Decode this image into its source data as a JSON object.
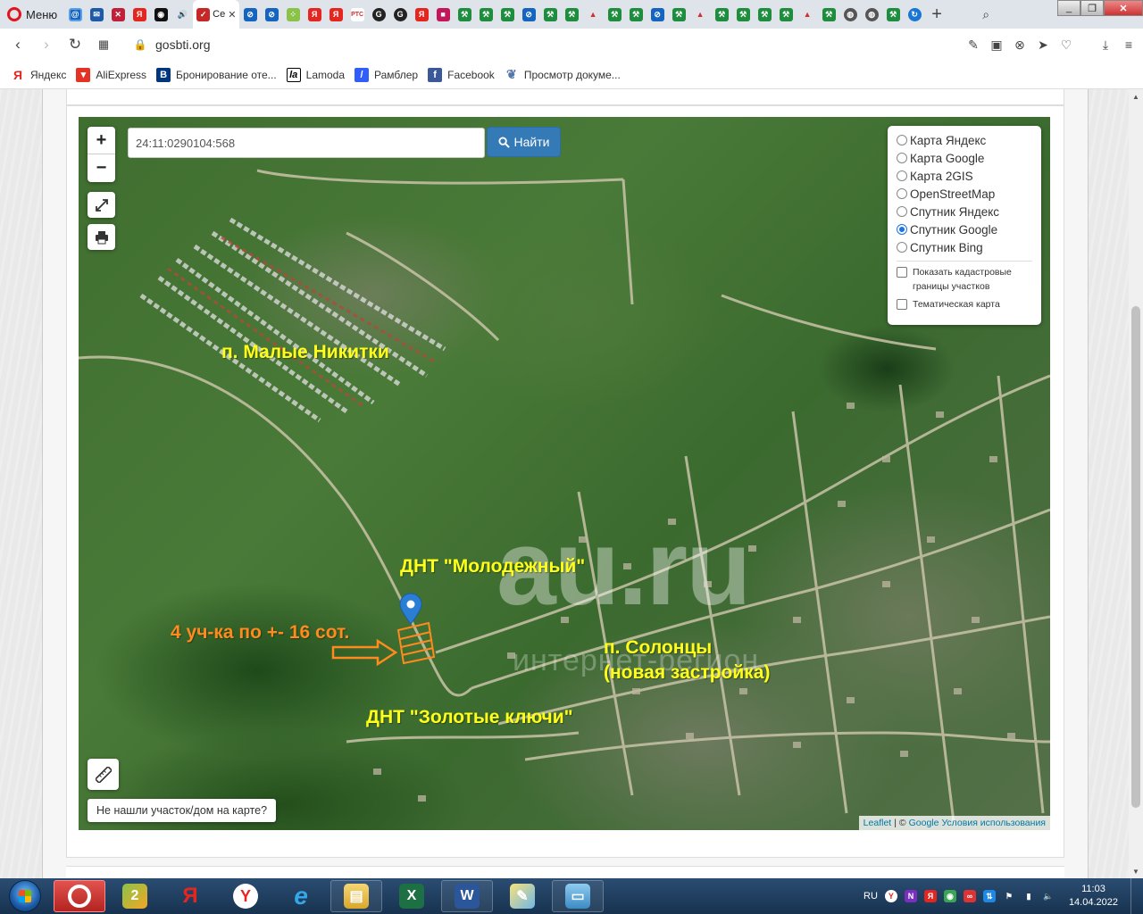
{
  "browser": {
    "menu_label": "Меню",
    "active_tab_label": "Се",
    "url": "gosbti.org",
    "bookmarks": [
      {
        "label": "Яндекс"
      },
      {
        "label": "AliExpress"
      },
      {
        "label": "Бронирование оте..."
      },
      {
        "label": "Lamoda"
      },
      {
        "label": "Рамблер"
      },
      {
        "label": "Facebook"
      },
      {
        "label": "Просмотр докуме..."
      }
    ]
  },
  "map": {
    "zoom_in": "+",
    "zoom_out": "−",
    "search_value": "24:11:0290104:568",
    "find_label": "Найти",
    "layers": [
      {
        "label": "Карта Яндекс",
        "checked": false
      },
      {
        "label": "Карта Google",
        "checked": false
      },
      {
        "label": "Карта 2GIS",
        "checked": false
      },
      {
        "label": "OpenStreetMap",
        "checked": false
      },
      {
        "label": "Спутник Яндекс",
        "checked": false
      },
      {
        "label": "Спутник Google",
        "checked": true
      },
      {
        "label": "Спутник Bing",
        "checked": false
      }
    ],
    "overlays": [
      {
        "label": "Показать кадастровые границы участков",
        "checked": false
      },
      {
        "label": "Тематическая карта",
        "checked": false
      }
    ],
    "labels": {
      "malye_nikitki": "п. Малые Никитки",
      "dnt_molodezhny": "ДНТ \"Молодежный\"",
      "plots_info": "4 уч-ка по +- 16 сот.",
      "solontsy_1": "п. Солонцы",
      "solontsy_2": "(новая застройка)",
      "dnt_zolotye": "ДНТ \"Золотые ключи\""
    },
    "watermark": "au.ru",
    "watermark_sub": "интернет-регион",
    "not_found_label": "Не нашли участок/дом на карте?",
    "attribution": {
      "leaflet": "Leaflet",
      "sep": "| ©",
      "google": "Google",
      "terms": "Условия использования"
    }
  },
  "taskbar": {
    "lang": "RU",
    "time": "11:03",
    "date": "14.04.2022"
  },
  "colors": {
    "label_yellow": "#ffff1a",
    "label_orange": "#ff8a1e",
    "find_button": "#337ab7",
    "marker": "#2a7fd4"
  }
}
